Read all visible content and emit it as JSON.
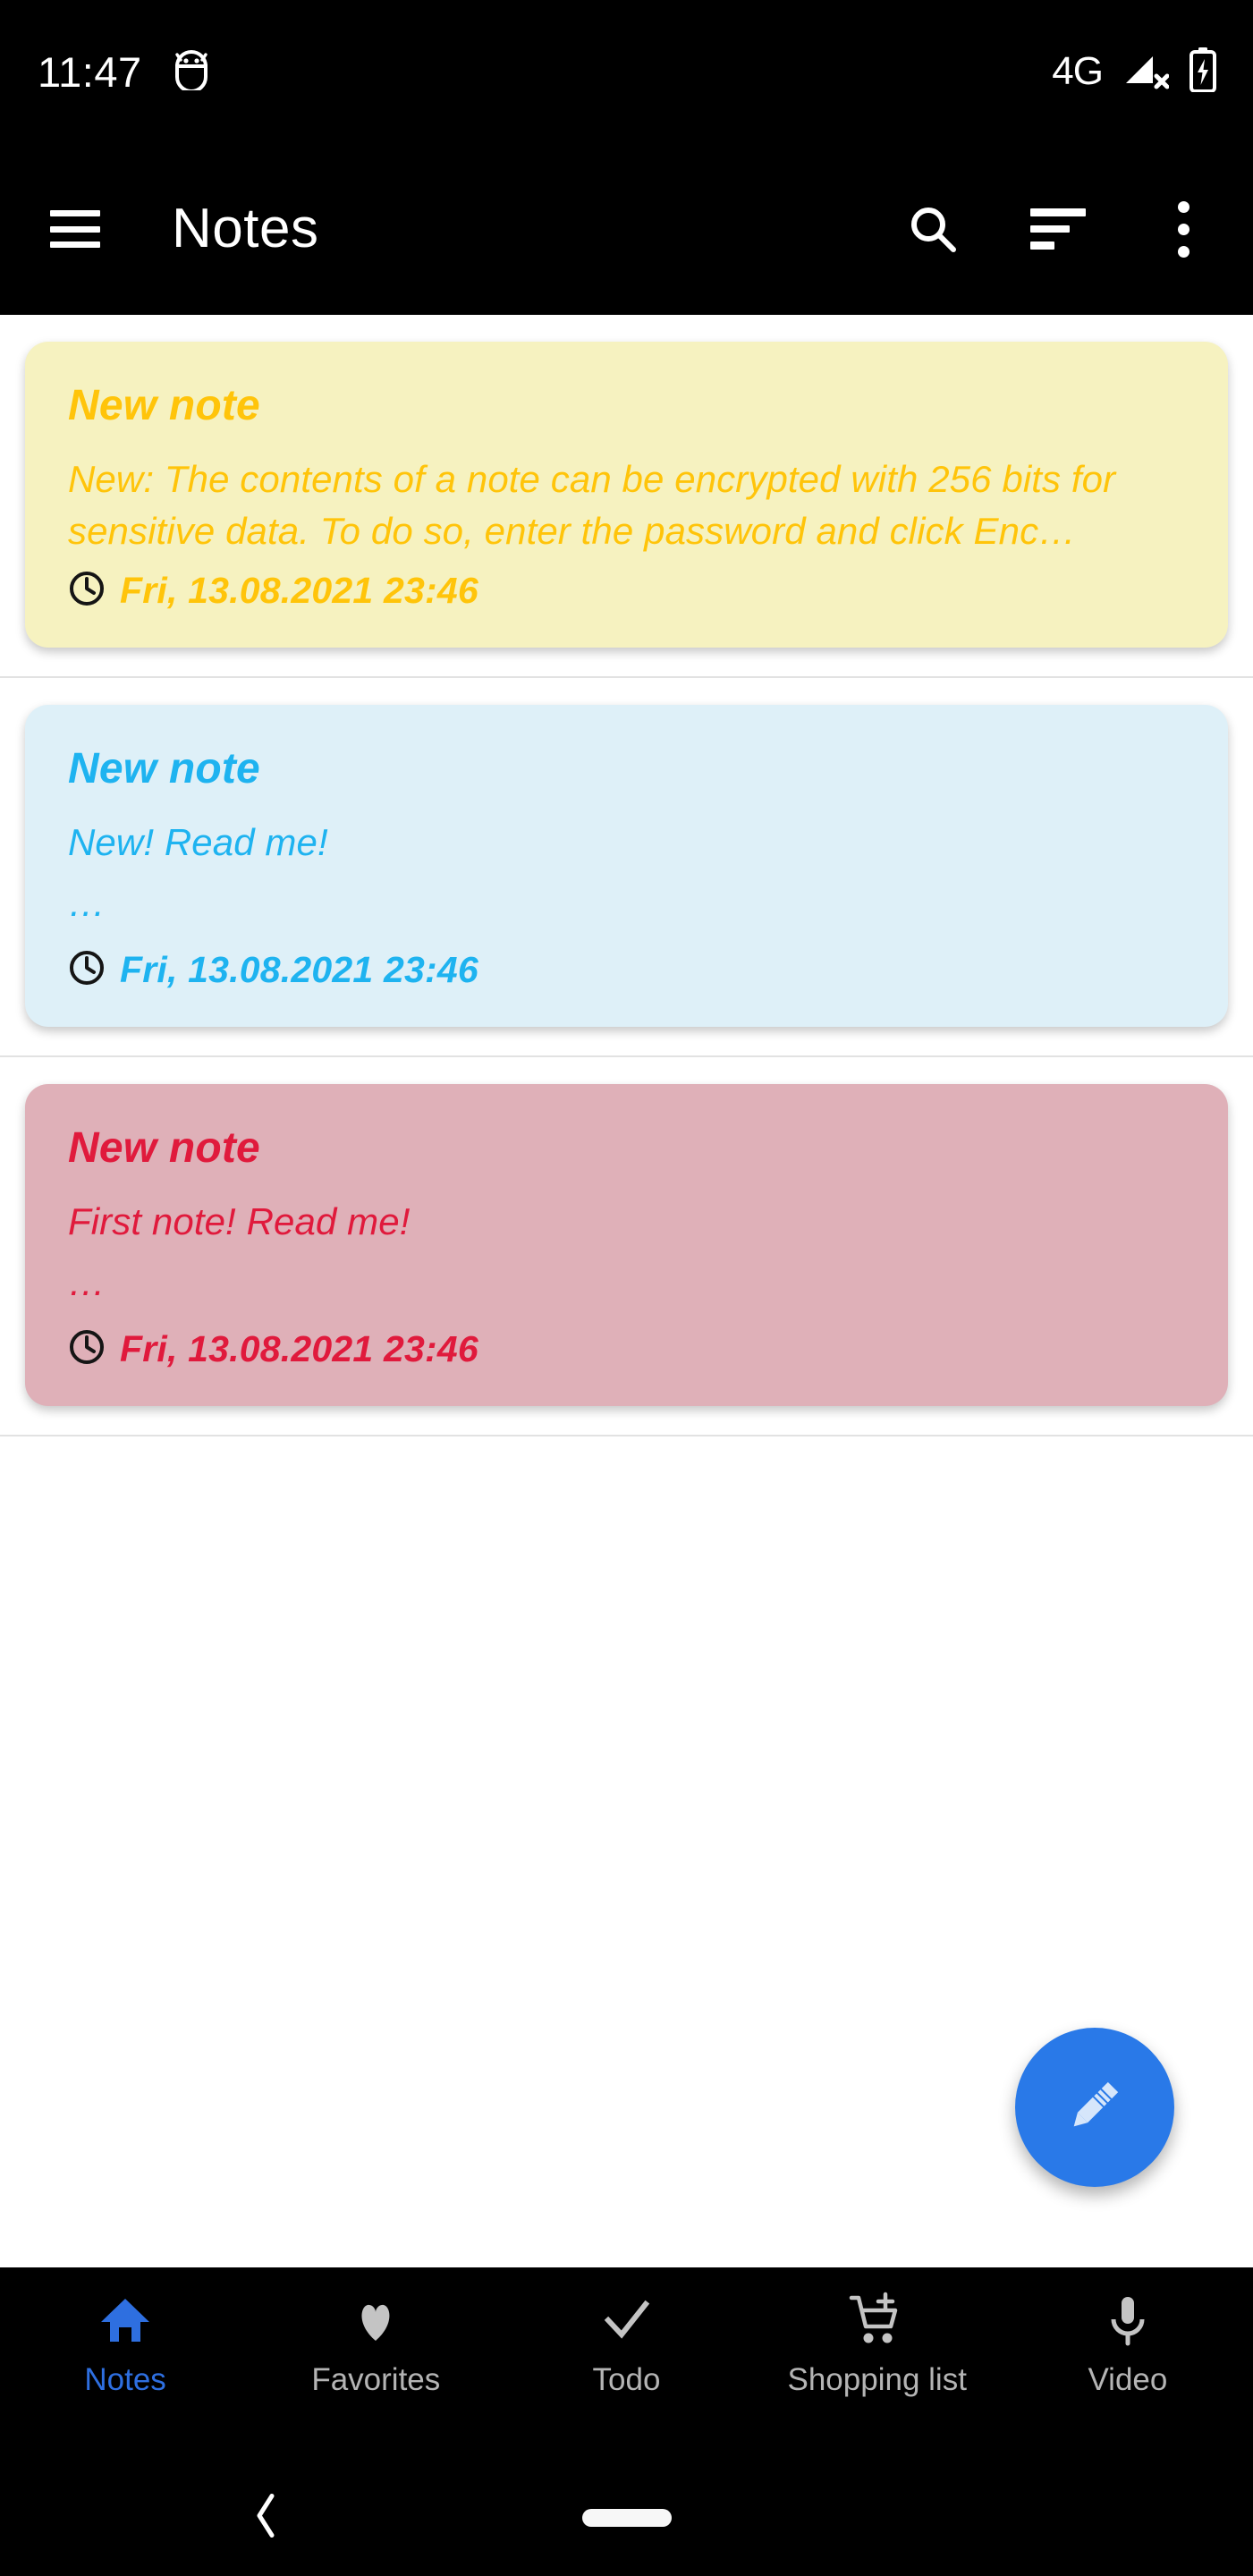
{
  "status_bar": {
    "time": "11:47",
    "debug_icon": "android-bug-icon",
    "network_label": "4G",
    "signal_icon": "signal-off-icon",
    "battery_icon": "battery-charging-icon"
  },
  "app_bar": {
    "menu_icon": "hamburger-menu-icon",
    "title": "Notes",
    "search_icon": "search-icon",
    "sort_icon": "sort-icon",
    "overflow_icon": "more-vertical-icon"
  },
  "notes": [
    {
      "title": "New note",
      "body": "New: The contents of a note can be encrypted with 256 bits for sensitive data. To do so, enter the password and click Enc…",
      "ellipsis": "",
      "date": "Fri, 13.08.2021 23:46",
      "bg_color": "#F6F2C0",
      "text_color": "#FFC40A"
    },
    {
      "title": "New note",
      "body": "New! Read me!",
      "ellipsis": "…",
      "date": "Fri, 13.08.2021 23:46",
      "bg_color": "#DEF0F8",
      "text_color": "#1EB3F0"
    },
    {
      "title": "New note",
      "body": "First note! Read me!",
      "ellipsis": "…",
      "date": "Fri, 13.08.2021 23:46",
      "bg_color": "#DFB0B8",
      "text_color": "#E01A3C"
    }
  ],
  "fab": {
    "icon": "pencil-icon",
    "color": "#2979E8"
  },
  "bottom_nav": {
    "active_color": "#2E6FE0",
    "inactive_color": "#b4b4b4",
    "items": [
      {
        "label": "Notes",
        "icon": "home-icon",
        "active": true
      },
      {
        "label": "Favorites",
        "icon": "heart-icon",
        "active": false
      },
      {
        "label": "Todo",
        "icon": "check-icon",
        "active": false
      },
      {
        "label": "Shopping list",
        "icon": "shopping-cart-add-icon",
        "active": false
      },
      {
        "label": "Video",
        "icon": "microphone-icon",
        "active": false
      }
    ]
  },
  "system_nav": {
    "back_icon": "back-chevron-icon",
    "home_indicator": "home-pill-indicator"
  }
}
